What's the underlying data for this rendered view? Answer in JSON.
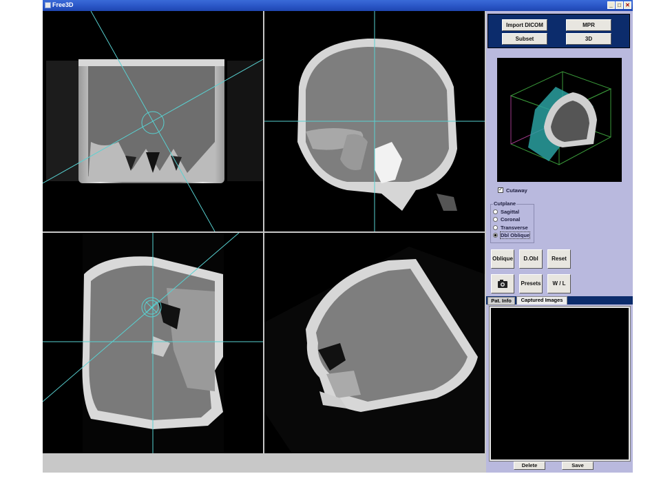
{
  "window": {
    "title": "Free3D",
    "minimize": "_",
    "maximize": "□",
    "close": "✕"
  },
  "toolbar": {
    "import_dicom": "Import DICOM",
    "mpr": "MPR",
    "subset": "Subset",
    "view_3d": "3D"
  },
  "options": {
    "cutaway_label": "Cutaway",
    "cutaway_checked": true
  },
  "cutplane": {
    "title": "Cutplane",
    "options": [
      "Sagittal",
      "Coronal",
      "Transverse",
      "Dbl Oblique"
    ],
    "selected": "Dbl Oblique"
  },
  "tools": {
    "oblique": "Oblique",
    "d_obl": "D.Obl",
    "reset": "Reset",
    "presets": "Presets",
    "wl": "W / L",
    "camera_icon": "camera-icon"
  },
  "tabs": [
    {
      "label": "Pat. Info"
    },
    {
      "label": "Captured Images",
      "active": true
    }
  ],
  "captured": {
    "delete": "Delete",
    "save": "Save"
  },
  "colors": {
    "crosshair": "#58d2d2",
    "titlebar": "#2a56c6",
    "panel": "#b9b9de",
    "navy": "#0c2c6c"
  }
}
